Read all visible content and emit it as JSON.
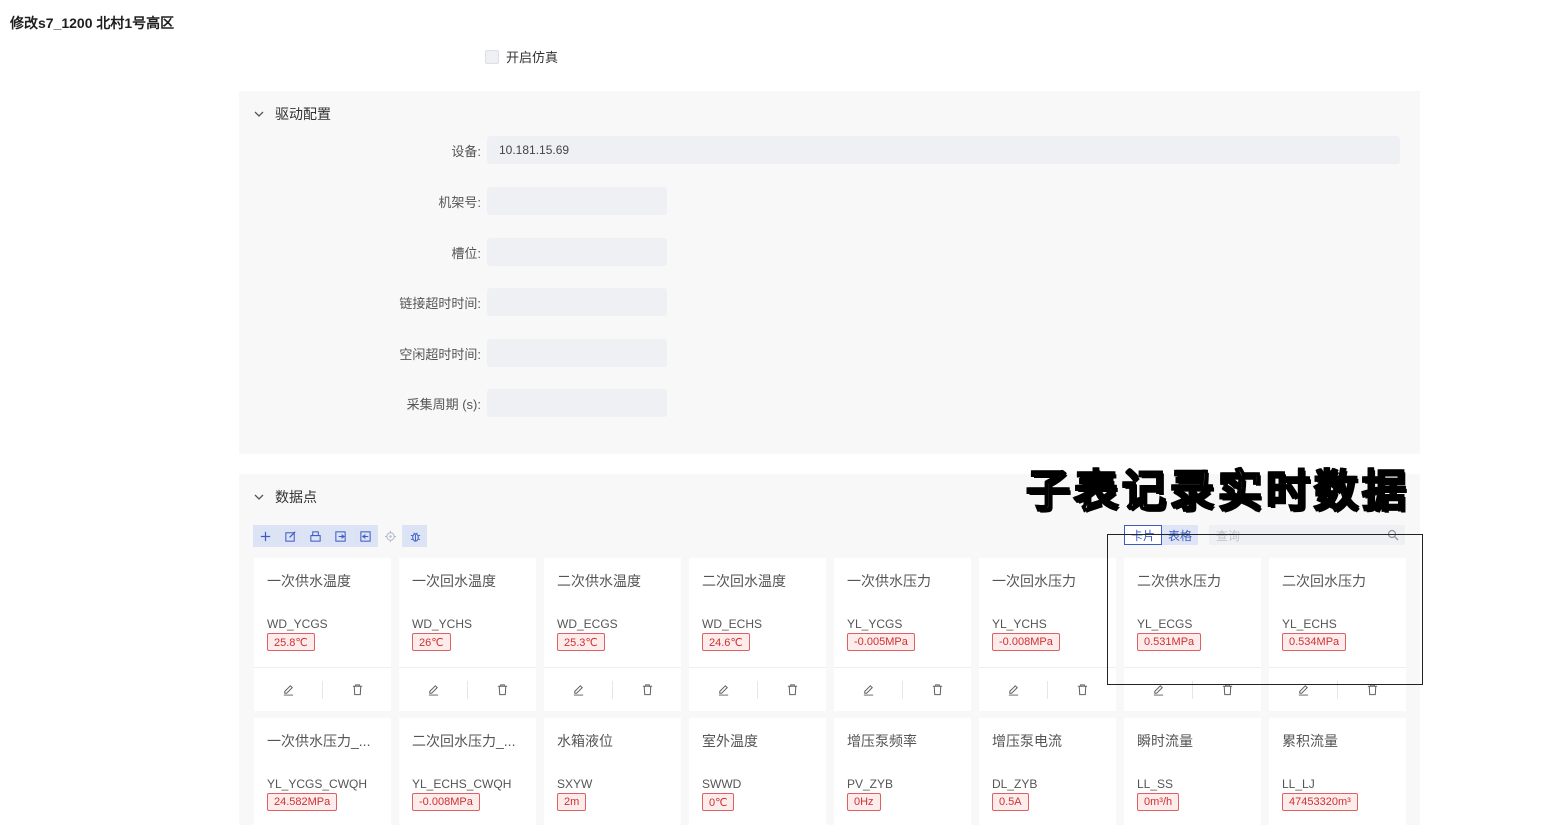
{
  "page": {
    "title": "修改s7_1200 北村1号高区"
  },
  "simulation": {
    "label": "开启仿真",
    "checked": false
  },
  "driver": {
    "header": "驱动配置",
    "fields": [
      {
        "label": "设备:",
        "value": "10.181.15.69"
      },
      {
        "label": "机架号:",
        "value": ""
      },
      {
        "label": "槽位:",
        "value": ""
      },
      {
        "label": "链接超时时间:",
        "value": ""
      },
      {
        "label": "空闲超时时间:",
        "value": ""
      },
      {
        "label": "采集周期 (s):",
        "value": ""
      }
    ]
  },
  "points": {
    "header": "数据点",
    "toolbar_icons": [
      "plus-icon",
      "edit-icon",
      "print-icon",
      "import-icon",
      "export-icon",
      "locate-icon",
      "debug-icon"
    ],
    "view": {
      "card_label": "卡片",
      "table_label": "表格",
      "active": "card"
    },
    "search": {
      "placeholder": "查询"
    },
    "cards": [
      {
        "name": "一次供水温度",
        "code": "WD_YCGS",
        "value": "25.8℃"
      },
      {
        "name": "一次回水温度",
        "code": "WD_YCHS",
        "value": "26℃"
      },
      {
        "name": "二次供水温度",
        "code": "WD_ECGS",
        "value": "25.3℃"
      },
      {
        "name": "二次回水温度",
        "code": "WD_ECHS",
        "value": "24.6℃"
      },
      {
        "name": "一次供水压力",
        "code": "YL_YCGS",
        "value": "-0.005MPa"
      },
      {
        "name": "一次回水压力",
        "code": "YL_YCHS",
        "value": "-0.008MPa"
      },
      {
        "name": "二次供水压力",
        "code": "YL_ECGS",
        "value": "0.531MPa"
      },
      {
        "name": "二次回水压力",
        "code": "YL_ECHS",
        "value": "0.534MPa"
      },
      {
        "name": "一次供水压力_...",
        "code": "YL_YCGS_CWQH",
        "value": "24.582MPa"
      },
      {
        "name": "二次回水压力_...",
        "code": "YL_ECHS_CWQH",
        "value": "-0.008MPa"
      },
      {
        "name": "水箱液位",
        "code": "SXYW",
        "value": "2m"
      },
      {
        "name": "室外温度",
        "code": "SWWD",
        "value": "0℃"
      },
      {
        "name": "增压泵频率",
        "code": "PV_ZYB",
        "value": "0Hz"
      },
      {
        "name": "增压泵电流",
        "code": "DL_ZYB",
        "value": "0.5A"
      },
      {
        "name": "瞬时流量",
        "code": "LL_SS",
        "value": "0m³/h"
      },
      {
        "name": "累积流量",
        "code": "LL_LJ",
        "value": "47453320m³"
      }
    ]
  },
  "annotation": {
    "text": "子表记录实时数据"
  },
  "colors": {
    "accent": "#3c5cc4",
    "value_red": "#d03030",
    "panel_bg": "#f8f8f9"
  }
}
